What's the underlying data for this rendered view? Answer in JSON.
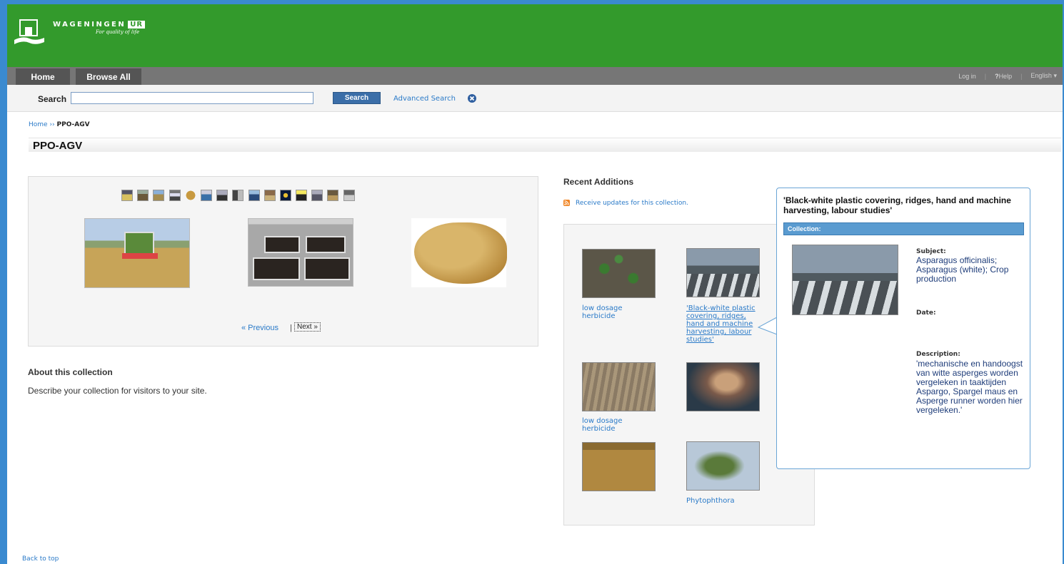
{
  "brand": {
    "name": "WAGENINGEN",
    "suffix": "UR",
    "tagline": "For quality of life"
  },
  "nav": {
    "tabs": [
      "Home",
      "Browse All"
    ],
    "login": "Log in",
    "help": "Help",
    "language": "English"
  },
  "search": {
    "label": "Search",
    "value": "",
    "button": "Search",
    "advanced": "Advanced Search"
  },
  "breadcrumb": {
    "home": "Home",
    "separator": "››",
    "current": "PPO-AGV"
  },
  "page_title": "PPO-AGV",
  "slider": {
    "prev": "« Previous",
    "separator": "|",
    "next": "Next »"
  },
  "about": {
    "heading": "About this collection",
    "text": "Describe your collection for visitors to your site."
  },
  "recent": {
    "heading": "Recent Additions",
    "rss": "Receive updates for this collection.",
    "items": [
      {
        "caption": "low dosage herbicide"
      },
      {
        "caption": "'Black-white plastic covering, ridges, hand and machine harvesting, labour studies'"
      },
      {
        "caption": "low dosage herbicide"
      },
      {
        "caption": ""
      },
      {
        "caption": ""
      },
      {
        "caption": "Phytophthora"
      }
    ]
  },
  "tooltip": {
    "title": "'Black-white plastic covering, ridges, hand and machine harvesting, labour studies'",
    "collection_label": "Collection:",
    "subject_label": "Subject:",
    "subject": "Asparagus officinalis; Asparagus (white); Crop production",
    "date_label": "Date:",
    "description_label": "Description:",
    "description": "'mechanische en handoogst van witte asperges worden vergeleken in taaktijden Aspargo, Spargel maus en Asperge runner worden hier vergeleken.'"
  },
  "footer": {
    "back_to_top": "Back to top"
  },
  "colors": {
    "header_green": "#339a2c",
    "rail_blue": "#3a8ad0",
    "link_blue": "#2a7ac8",
    "button_blue": "#3b6ea8"
  }
}
